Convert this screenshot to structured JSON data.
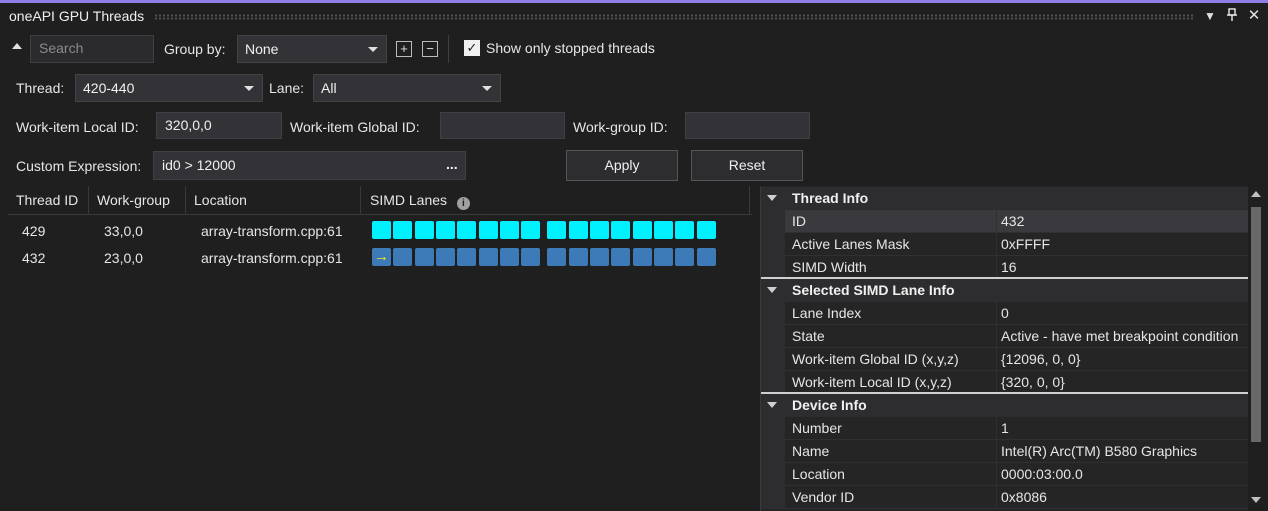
{
  "window": {
    "title": "oneAPI GPU Threads"
  },
  "toolbar": {
    "search_placeholder": "Search",
    "group_by_label": "Group by:",
    "group_by_value": "None",
    "expand_all": "+",
    "collapse_all": "−",
    "show_stopped_label": "Show only stopped threads",
    "show_stopped_checked": true
  },
  "filters": {
    "thread_label": "Thread:",
    "thread_value": "420-440",
    "lane_label": "Lane:",
    "lane_value": "All",
    "local_id_label": "Work-item Local ID:",
    "local_id_value": "320,0,0",
    "global_id_label": "Work-item Global ID:",
    "global_id_value": "",
    "workgroup_id_label": "Work-group ID:",
    "workgroup_id_value": "",
    "custom_expr_label": "Custom Expression:",
    "custom_expr_value": "id0 > 12000",
    "custom_expr_more": "...",
    "apply_label": "Apply",
    "reset_label": "Reset"
  },
  "table": {
    "columns": [
      "Thread ID",
      "Work-group",
      "Location",
      "SIMD Lanes"
    ],
    "rows": [
      {
        "thread_id": "429",
        "work_group": "33,0,0",
        "location": "array-transform.cpp:61",
        "lanes": "active"
      },
      {
        "thread_id": "432",
        "work_group": "23,0,0",
        "location": "array-transform.cpp:61",
        "lanes": "current"
      }
    ],
    "lane_count": 16
  },
  "properties": {
    "thread_info": {
      "title": "Thread Info",
      "rows": [
        {
          "name": "ID",
          "value": "432"
        },
        {
          "name": "Active Lanes Mask",
          "value": "0xFFFF"
        },
        {
          "name": "SIMD Width",
          "value": "16"
        }
      ]
    },
    "lane_info": {
      "title": "Selected SIMD Lane Info",
      "rows": [
        {
          "name": "Lane Index",
          "value": "0"
        },
        {
          "name": "State",
          "value": "Active - have met breakpoint condition"
        },
        {
          "name": "Work-item Global ID (x,y,z)",
          "value": "{12096, 0, 0}"
        },
        {
          "name": "Work-item Local ID (x,y,z)",
          "value": "{320, 0, 0}"
        }
      ]
    },
    "device_info": {
      "title": "Device Info",
      "rows": [
        {
          "name": "Number",
          "value": "1"
        },
        {
          "name": "Name",
          "value": "Intel(R) Arc(TM) B580 Graphics"
        },
        {
          "name": "Location",
          "value": "0000:03:00.0"
        },
        {
          "name": "Vendor ID",
          "value": "0x8086"
        }
      ]
    }
  },
  "colors": {
    "accent": "#8f7ee8",
    "lane_active": "#00f0ff",
    "lane_inactive": "#3d7bb8",
    "current_arrow": "#f0e61e"
  },
  "icons": {
    "dropdown_pin": "chevron-down-icon",
    "pin": "pin-icon",
    "close": "close-icon",
    "collapse_toolbar": "triangle-up-icon",
    "info": "info-icon",
    "current_lane": "arrow-right-icon"
  }
}
